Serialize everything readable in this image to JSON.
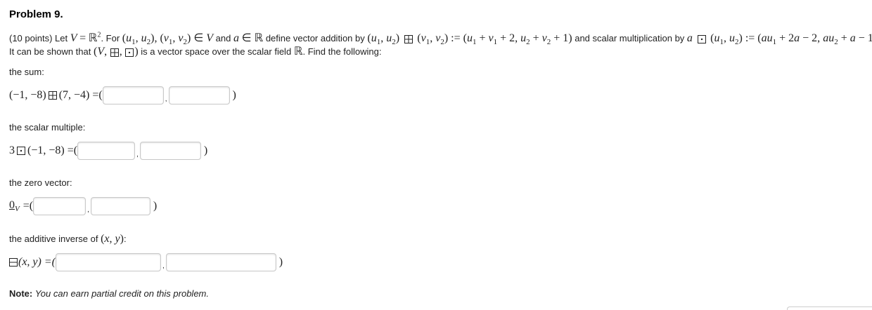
{
  "problem": {
    "title": "Problem 9.",
    "points": "(10 points)",
    "intro_line2": "It can be shown that",
    "intro_line2_end": "is a vector space over the scalar field",
    "find": ". Find the following:"
  },
  "parts": {
    "sum_label": "the sum:",
    "scalar_label": "the scalar multiple:",
    "zero_label": "the zero vector:",
    "inverse_label": "the additive inverse of",
    "inverse_label_end": ":"
  },
  "expressions": {
    "sum_left": "(−1, −8)",
    "sum_right": "(7, −4) =(",
    "scalar_left": "3",
    "scalar_right": "(−1, −8) =(",
    "zero_left": "=(",
    "inverse_left": "(x, y) =(",
    "close_paren": ")",
    "comma": ","
  },
  "inputs": {
    "sum_1": "",
    "sum_2": "",
    "scalar_1": "",
    "scalar_2": "",
    "zero_1": "",
    "zero_2": "",
    "inverse_1": "",
    "inverse_2": ""
  },
  "note": {
    "label": "Note:",
    "text": "You can earn partial credit on this problem."
  },
  "colors": {
    "text": "#222222",
    "input_border": "#c8c8c8"
  },
  "icons": {
    "boxplus": "boxed-plus-icon",
    "boxdot": "boxed-dot-icon",
    "boxminus": "boxed-minus-icon"
  }
}
